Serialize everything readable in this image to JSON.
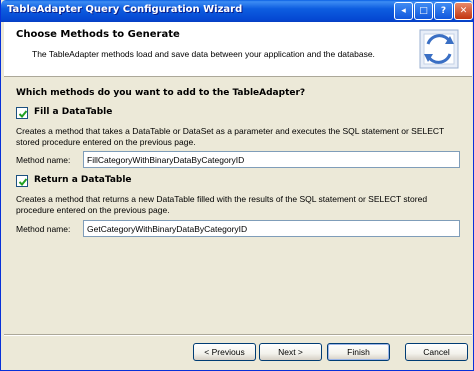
{
  "window": {
    "title": "TableAdapter Query Configuration Wizard",
    "titlebar_buttons": {
      "back": "◂",
      "maximize": "□",
      "help": "?",
      "close": "✕"
    }
  },
  "header": {
    "title": "Choose Methods to Generate",
    "description": "The TableAdapter methods load and save data between your application and the database.",
    "icon": "table-adapter-refresh-icon"
  },
  "main": {
    "question": "Which methods do you want to add to the TableAdapter?",
    "fill": {
      "checked": true,
      "label": "Fill a DataTable",
      "description": "Creates a method that takes a DataTable or DataSet as a parameter and executes the SQL statement or SELECT stored procedure entered on the previous page.",
      "method_label": "Method name:",
      "method_value": "FillCategoryWithBinaryDataByCategoryID"
    },
    "return": {
      "checked": true,
      "label": "Return a DataTable",
      "description": "Creates a method that returns a new DataTable filled with the results of the SQL statement or SELECT stored procedure entered on the previous page.",
      "method_label": "Method name:",
      "method_value": "GetCategoryWithBinaryDataByCategoryID"
    }
  },
  "footer": {
    "previous": "< Previous",
    "next": "Next >",
    "finish": "Finish",
    "cancel": "Cancel"
  },
  "colors": {
    "titlebar": "#0548d3",
    "dialog_bg": "#ece9d8",
    "checkbox_check": "#21a121"
  }
}
